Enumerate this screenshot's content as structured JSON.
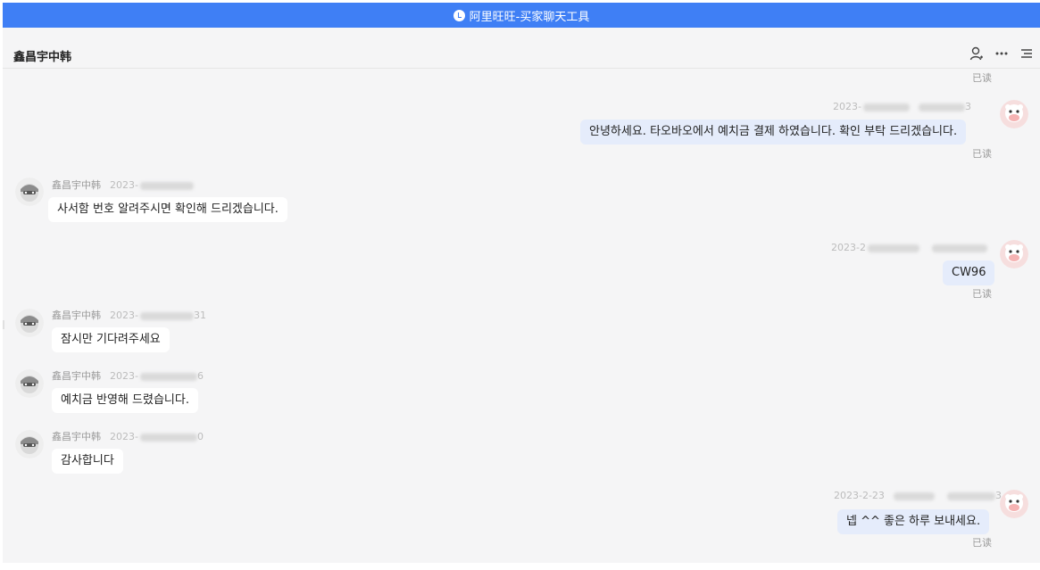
{
  "window": {
    "title": "阿里旺旺-买家聊天工具"
  },
  "header": {
    "contact_name": "鑫昌宇中韩"
  },
  "messages": {
    "read0": "已读",
    "m1": {
      "date": "2023-",
      "time_end": "3",
      "text": "안녕하세요. 타오바오에서 예치금 결제 하였습니다. 확인 부탁 드리겠습니다.",
      "read": "已读"
    },
    "m2": {
      "sender": "鑫昌宇中韩",
      "date": "2023-",
      "time_end": "",
      "text": "사서함 번호 알려주시면 확인해 드리겠습니다."
    },
    "m3": {
      "date": "2023-2",
      "time_end": "",
      "text": "CW96",
      "read": "已读"
    },
    "m4": {
      "sender": "鑫昌宇中韩",
      "date": "2023-",
      "time_end": "31",
      "text": "잠시만 기다려주세요"
    },
    "m5": {
      "sender": "鑫昌宇中韩",
      "date": "2023-",
      "time_end": "6",
      "text": "예치금 반영해 드렸습니다."
    },
    "m6": {
      "sender": "鑫昌宇中韩",
      "date": "2023-",
      "time_end": "0",
      "text": "감사합니다"
    },
    "m7": {
      "date": "2023-2-23",
      "time_end": "3",
      "text": "넵 ^^ 좋은 하루 보내세요.",
      "read": "已读"
    }
  },
  "icons": {
    "contact": "person-icon",
    "more": "more-dots-icon",
    "menu": "menu-lines-icon",
    "title_logo": "wangwang-logo-icon"
  },
  "colors": {
    "titlebar": "#3f7ff5",
    "outgoing_bubble": "#e5ecfb",
    "incoming_bubble": "#ffffff",
    "background": "#f5f5f6"
  }
}
